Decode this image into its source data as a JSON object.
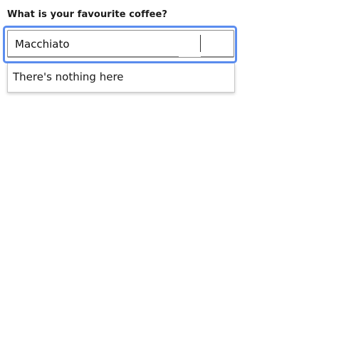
{
  "form": {
    "label": "What is your favourite coffee?",
    "input_value": "Macchiato",
    "input_placeholder": ""
  },
  "listbox": {
    "empty_message": "There's nothing here"
  },
  "colors": {
    "focus_ring": "#5b8def",
    "border": "#8a8a8a",
    "text": "#111111"
  }
}
